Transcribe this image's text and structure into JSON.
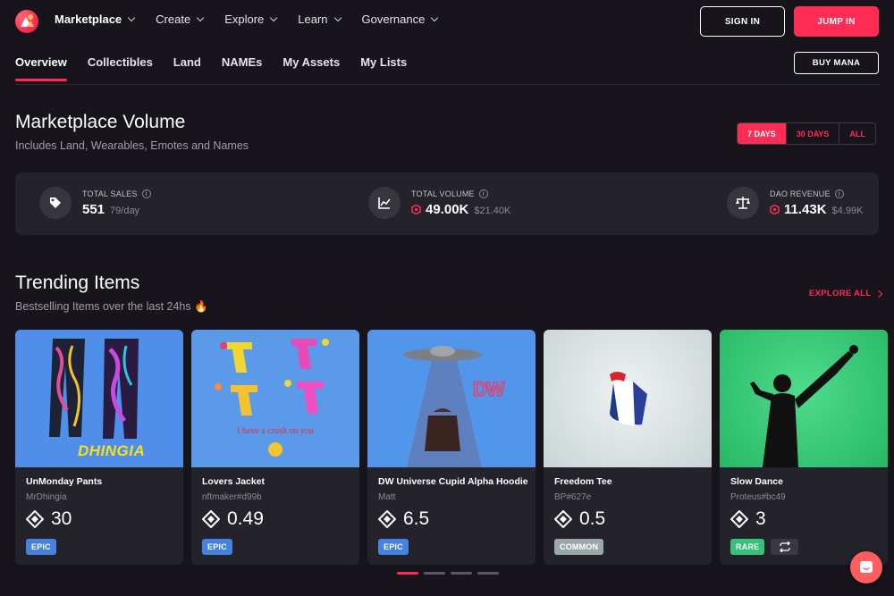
{
  "topnav": {
    "items": [
      {
        "label": "Marketplace",
        "active": true
      },
      {
        "label": "Create"
      },
      {
        "label": "Explore"
      },
      {
        "label": "Learn"
      },
      {
        "label": "Governance"
      }
    ],
    "sign_in": "SIGN IN",
    "jump_in": "JUMP IN"
  },
  "subnav": {
    "tabs": [
      "Overview",
      "Collectibles",
      "Land",
      "NAMEs",
      "My Assets",
      "My Lists"
    ],
    "buy_mana": "BUY MANA"
  },
  "volume": {
    "title": "Marketplace Volume",
    "subtitle": "Includes Land, Wearables, Emotes and Names",
    "ranges": [
      "7 DAYS",
      "30 DAYS",
      "ALL"
    ],
    "selected_range": "7 DAYS",
    "stats": [
      {
        "label": "TOTAL SALES",
        "value": "551",
        "secondary": "79/day",
        "icon": "tag-icon"
      },
      {
        "label": "TOTAL VOLUME",
        "value": "49.00K",
        "secondary": "$21.40K",
        "icon": "chart-icon"
      },
      {
        "label": "DAO REVENUE",
        "value": "11.43K",
        "secondary": "$4.99K",
        "icon": "scale-icon"
      }
    ]
  },
  "trending": {
    "title": "Trending Items",
    "subtitle": "Bestselling Items over the last 24hs 🔥",
    "explore_all": "EXPLORE ALL",
    "items": [
      {
        "name": "UnMonday Pants",
        "creator": "MrDhingia",
        "price": "30",
        "rarity": "EPIC",
        "thumb_text": "DHINGIA"
      },
      {
        "name": "Lovers Jacket",
        "creator": "nftmaker#d99b",
        "price": "0.49",
        "rarity": "EPIC",
        "thumb_text": "I have a crush on you"
      },
      {
        "name": "DW Universe Cupid Alpha Hoodie",
        "creator": "Matt",
        "price": "6.5",
        "rarity": "EPIC",
        "thumb_text": "DW"
      },
      {
        "name": "Freedom Tee",
        "creator": "BP#627e",
        "price": "0.5",
        "rarity": "COMMON",
        "thumb_text": ""
      },
      {
        "name": "Slow Dance",
        "creator": "Proteus#bc49",
        "price": "3",
        "rarity": "RARE",
        "thumb_text": ""
      }
    ]
  },
  "colors": {
    "accent": "#ff2d55",
    "epic": "#4682e0",
    "common": "#9aa8aa",
    "rare": "#36c27a"
  }
}
